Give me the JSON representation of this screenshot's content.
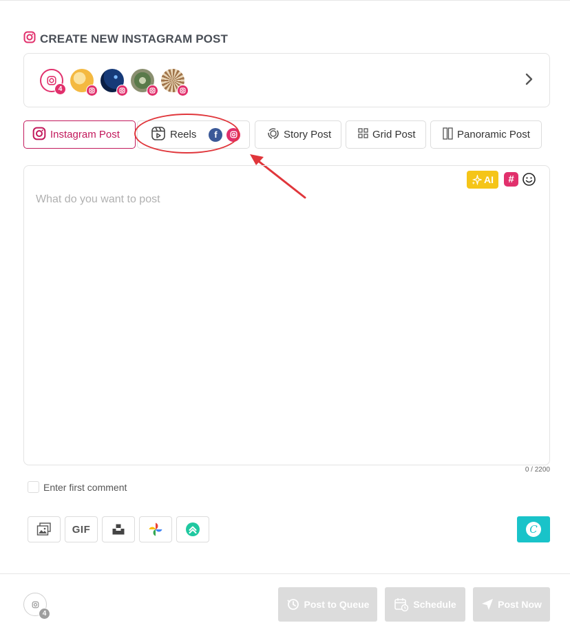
{
  "header": {
    "title": "CREATE NEW INSTAGRAM POST",
    "icon": "instagram-icon"
  },
  "accounts": {
    "selected_count": "4",
    "items": [
      "account-1",
      "account-2",
      "account-3",
      "account-4"
    ]
  },
  "tabs": [
    {
      "label": "Instagram Post",
      "active": true
    },
    {
      "label": "Reels"
    },
    {
      "label": "Story Post"
    },
    {
      "label": "Grid Post"
    },
    {
      "label": "Panoramic Post"
    }
  ],
  "editor": {
    "placeholder": "What do you want to post",
    "ai_label": "AI",
    "hashtag_label": "#",
    "char_counter": "0 / 2200"
  },
  "first_comment": {
    "label": "Enter first comment"
  },
  "media_tools": {
    "gif_label": "GIF"
  },
  "footer": {
    "account_count": "4",
    "post_to_queue": "Post to Queue",
    "schedule": "Schedule",
    "post_now": "Post Now"
  },
  "colors": {
    "brand": "#e1306c",
    "active_tab": "#c2185b",
    "annotation": "#e0363b",
    "ai": "#f5c518",
    "canva": "#19c3c9",
    "disabled": "#dcdcdc"
  }
}
